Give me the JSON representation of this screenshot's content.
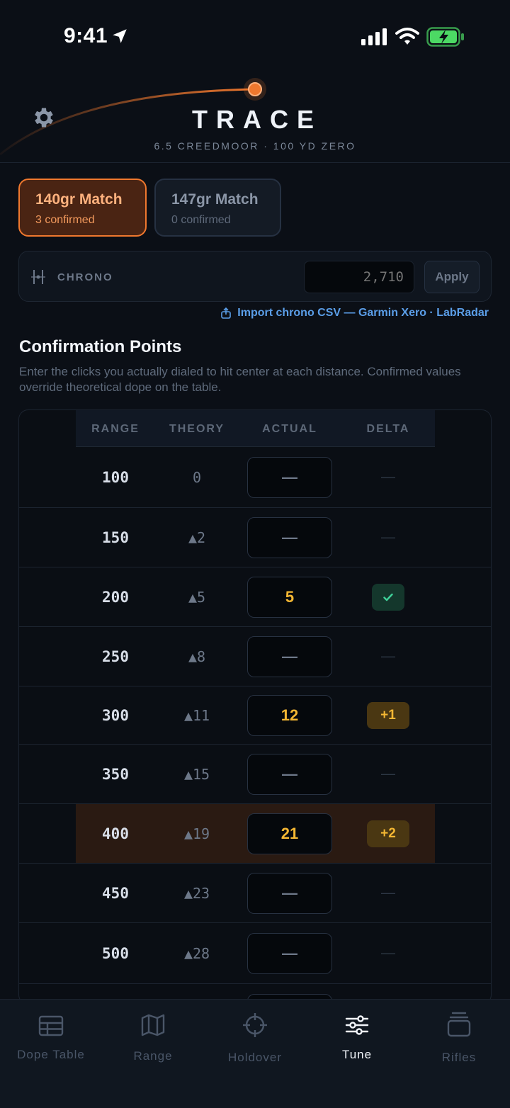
{
  "status_bar": {
    "time": "9:41"
  },
  "header": {
    "title": "TRACE",
    "subtitle": "6.5 CREEDMOOR · 100 YD ZERO",
    "accent": "#f0782e"
  },
  "loads": [
    {
      "name": "140gr Match",
      "status": "3 confirmed",
      "active": true
    },
    {
      "name": "147gr Match",
      "status": "0 confirmed",
      "active": false
    }
  ],
  "chrono": {
    "label": "CHRONO",
    "placeholder": "2,710",
    "apply_label": "Apply",
    "import_label": "Import chrono CSV — Garmin Xero · LabRadar"
  },
  "confirmation": {
    "title": "Confirmation Points",
    "description": "Enter the clicks you actually dialed to hit center at each distance. Confirmed values override theoretical dope on the table.",
    "columns": [
      "RANGE",
      "THEORY",
      "ACTUAL",
      "DELTA"
    ],
    "rows": [
      {
        "range": "100",
        "theory": "0",
        "actual": "—",
        "delta": "—"
      },
      {
        "range": "150",
        "theory": "▲2",
        "actual": "—",
        "delta": "—"
      },
      {
        "range": "200",
        "theory": "▲5",
        "actual": "5",
        "delta": "check"
      },
      {
        "range": "250",
        "theory": "▲8",
        "actual": "—",
        "delta": "—"
      },
      {
        "range": "300",
        "theory": "▲11",
        "actual": "12",
        "delta": "+1"
      },
      {
        "range": "350",
        "theory": "▲15",
        "actual": "—",
        "delta": "—"
      },
      {
        "range": "400",
        "theory": "▲19",
        "actual": "21",
        "delta": "+2",
        "highlight": true
      },
      {
        "range": "450",
        "theory": "▲23",
        "actual": "—",
        "delta": "—"
      },
      {
        "range": "500",
        "theory": "▲28",
        "actual": "—",
        "delta": "—"
      }
    ]
  },
  "tabs": [
    {
      "label": "Dope Table",
      "icon": "table-icon"
    },
    {
      "label": "Range",
      "icon": "map-icon"
    },
    {
      "label": "Holdover",
      "icon": "crosshair-icon"
    },
    {
      "label": "Tune",
      "icon": "sliders-icon",
      "active": true
    },
    {
      "label": "Rifles",
      "icon": "stack-icon"
    }
  ]
}
